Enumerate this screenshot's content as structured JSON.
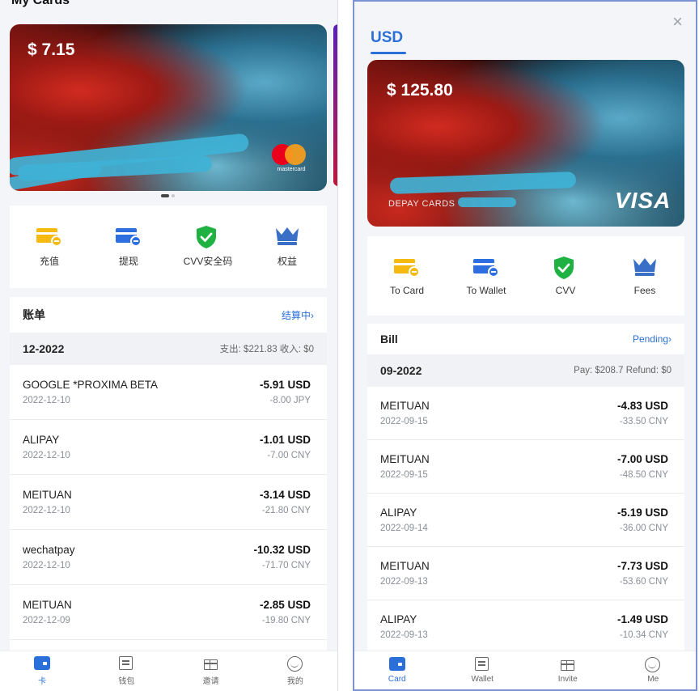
{
  "left": {
    "header_title": "My Cards",
    "card": {
      "balance": "$ 7.15",
      "network_text": "mastercard"
    },
    "actions": [
      {
        "label": "充值",
        "icon": "top-up-card-icon"
      },
      {
        "label": "提现",
        "icon": "withdraw-card-icon"
      },
      {
        "label": "CVV安全码",
        "icon": "shield-check-icon"
      },
      {
        "label": "权益",
        "icon": "crown-icon"
      }
    ],
    "bill": {
      "title": "账单",
      "status": "结算中",
      "month": "12-2022",
      "summary": "支出: $221.83  收入: $0",
      "transactions": [
        {
          "merchant": "GOOGLE *PROXIMA BETA",
          "date": "2022-12-10",
          "amount": "-5.91 USD",
          "original": "-8.00 JPY"
        },
        {
          "merchant": "ALIPAY",
          "date": "2022-12-10",
          "amount": "-1.01 USD",
          "original": "-7.00 CNY"
        },
        {
          "merchant": "MEITUAN",
          "date": "2022-12-10",
          "amount": "-3.14 USD",
          "original": "-21.80 CNY"
        },
        {
          "merchant": "wechatpay",
          "date": "2022-12-10",
          "amount": "-10.32 USD",
          "original": "-71.70 CNY"
        },
        {
          "merchant": "MEITUAN",
          "date": "2022-12-09",
          "amount": "-2.85 USD",
          "original": "-19.80 CNY"
        }
      ]
    },
    "tabs": [
      {
        "label": "卡",
        "icon": "card-icon",
        "active": true
      },
      {
        "label": "钱包",
        "icon": "wallet-icon",
        "active": false
      },
      {
        "label": "邀请",
        "icon": "gift-icon",
        "active": false
      },
      {
        "label": "我的",
        "icon": "profile-icon",
        "active": false
      }
    ]
  },
  "right": {
    "currency_tab": "USD",
    "close_glyph": "×",
    "card": {
      "balance": "$ 125.80",
      "brand_text": "DEPAY CARDS",
      "network": "VISA"
    },
    "actions": [
      {
        "label": "To Card",
        "icon": "to-card-icon"
      },
      {
        "label": "To Wallet",
        "icon": "to-wallet-icon"
      },
      {
        "label": "CVV",
        "icon": "shield-check-icon"
      },
      {
        "label": "Fees",
        "icon": "crown-icon"
      }
    ],
    "bill": {
      "title": "Bill",
      "status": "Pending",
      "month": "09-2022",
      "summary": "Pay: $208.7  Refund: $0",
      "transactions": [
        {
          "merchant": "MEITUAN",
          "date": "2022-09-15",
          "amount": "-4.83 USD",
          "original": "-33.50 CNY"
        },
        {
          "merchant": "MEITUAN",
          "date": "2022-09-15",
          "amount": "-7.00 USD",
          "original": "-48.50 CNY"
        },
        {
          "merchant": "ALIPAY",
          "date": "2022-09-14",
          "amount": "-5.19 USD",
          "original": "-36.00 CNY"
        },
        {
          "merchant": "MEITUAN",
          "date": "2022-09-13",
          "amount": "-7.73 USD",
          "original": "-53.60 CNY"
        },
        {
          "merchant": "ALIPAY",
          "date": "2022-09-13",
          "amount": "-1.49 USD",
          "original": "-10.34 CNY"
        }
      ]
    },
    "tabs": [
      {
        "label": "Card",
        "icon": "card-icon",
        "active": true
      },
      {
        "label": "Wallet",
        "icon": "wallet-icon",
        "active": false
      },
      {
        "label": "Invite",
        "icon": "gift-icon",
        "active": false
      },
      {
        "label": "Me",
        "icon": "profile-icon",
        "active": false
      }
    ]
  },
  "colors": {
    "accent": "#2b6fd9",
    "yellow": "#f5b90f",
    "green": "#1fb141",
    "crown": "#3a6fc8"
  },
  "chevron": "›"
}
